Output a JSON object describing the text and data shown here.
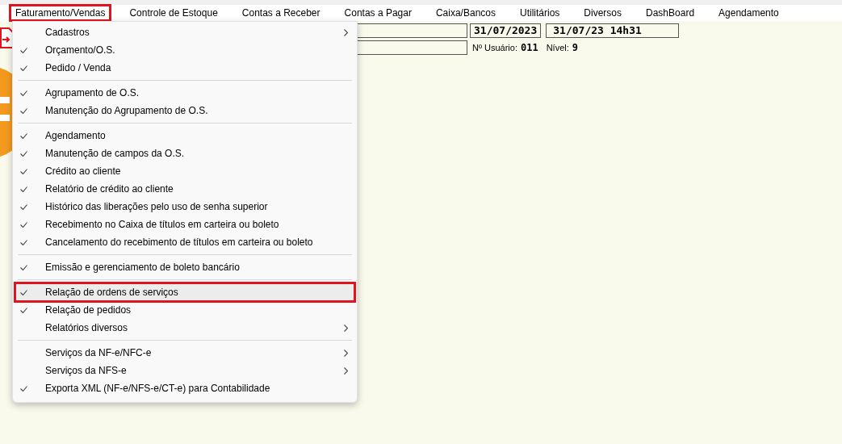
{
  "menubar": [
    {
      "label": "Faturamento/Vendas",
      "highlighted": true
    },
    {
      "label": "Controle de Estoque",
      "highlighted": false
    },
    {
      "label": "Contas a Receber",
      "highlighted": false
    },
    {
      "label": "Contas a Pagar",
      "highlighted": false
    },
    {
      "label": "Caixa/Bancos",
      "highlighted": false
    },
    {
      "label": "Utilitários",
      "highlighted": false
    },
    {
      "label": "Diversos",
      "highlighted": false
    },
    {
      "label": "DashBoard",
      "highlighted": false
    },
    {
      "label": "Agendamento",
      "highlighted": false
    }
  ],
  "status_fields": {
    "date": "31/07/2023",
    "datetime": "31/07/23 14h31",
    "user_label": "Nº Usuário:",
    "user_value": "011",
    "level_label": "Nível:",
    "level_value": "9"
  },
  "menu": {
    "groups": [
      [
        {
          "label": "Cadastros",
          "checked": false,
          "submenu": true,
          "selected": false,
          "highlighted": false
        },
        {
          "label": "Orçamento/O.S.",
          "checked": true,
          "submenu": false,
          "selected": false,
          "highlighted": false
        },
        {
          "label": "Pedido / Venda",
          "checked": true,
          "submenu": false,
          "selected": false,
          "highlighted": false
        }
      ],
      [
        {
          "label": "Agrupamento de O.S.",
          "checked": true,
          "submenu": false,
          "selected": false,
          "highlighted": false
        },
        {
          "label": "Manutenção do Agrupamento de O.S.",
          "checked": true,
          "submenu": false,
          "selected": false,
          "highlighted": false
        }
      ],
      [
        {
          "label": "Agendamento",
          "checked": true,
          "submenu": false,
          "selected": false,
          "highlighted": false
        },
        {
          "label": "Manutenção de campos da O.S.",
          "checked": true,
          "submenu": false,
          "selected": false,
          "highlighted": false
        },
        {
          "label": "Crédito ao cliente",
          "checked": true,
          "submenu": false,
          "selected": false,
          "highlighted": false
        },
        {
          "label": "Relatório de crédito ao cliente",
          "checked": true,
          "submenu": false,
          "selected": false,
          "highlighted": false
        },
        {
          "label": "Histórico das liberações pelo uso de senha superior",
          "checked": true,
          "submenu": false,
          "selected": false,
          "highlighted": false
        },
        {
          "label": "Recebimento no Caixa de títulos em carteira ou boleto",
          "checked": true,
          "submenu": false,
          "selected": false,
          "highlighted": false
        },
        {
          "label": "Cancelamento do recebimento de títulos em carteira ou boleto",
          "checked": true,
          "submenu": false,
          "selected": false,
          "highlighted": false
        }
      ],
      [
        {
          "label": "Emissão e gerenciamento de boleto bancário",
          "checked": true,
          "submenu": false,
          "selected": false,
          "highlighted": false
        }
      ],
      [
        {
          "label": "Relação de ordens de serviços",
          "checked": true,
          "submenu": false,
          "selected": true,
          "highlighted": true
        },
        {
          "label": "Relação de pedidos",
          "checked": true,
          "submenu": false,
          "selected": false,
          "highlighted": false
        },
        {
          "label": "Relatórios diversos",
          "checked": false,
          "submenu": true,
          "selected": false,
          "highlighted": false
        }
      ],
      [
        {
          "label": "Serviços da NF-e/NFC-e",
          "checked": false,
          "submenu": true,
          "selected": false,
          "highlighted": false
        },
        {
          "label": "Serviços da NFS-e",
          "checked": false,
          "submenu": true,
          "selected": false,
          "highlighted": false
        },
        {
          "label": "Exporta XML (NF-e/NFS-e/CT-e) para Contabilidade",
          "checked": true,
          "submenu": false,
          "selected": false,
          "highlighted": false
        }
      ]
    ]
  }
}
